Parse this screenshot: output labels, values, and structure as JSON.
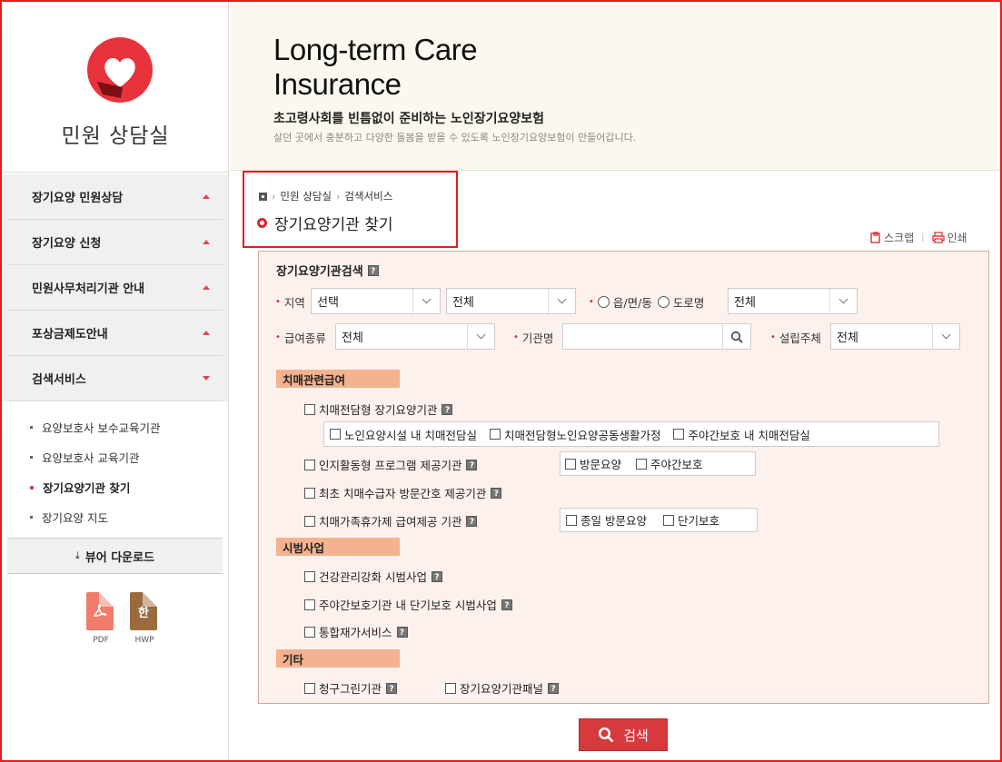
{
  "sidebar": {
    "title": "민원 상담실",
    "menu": [
      {
        "label": "장기요양 민원상담",
        "expanded": false
      },
      {
        "label": "장기요양 신청",
        "expanded": false
      },
      {
        "label": "민원사무처리기관 안내",
        "expanded": false
      },
      {
        "label": "포상금제도안내",
        "expanded": false
      },
      {
        "label": "검색서비스",
        "expanded": true
      }
    ],
    "submenu": [
      "요양보호사 보수교육기관",
      "요양보호사 교육기관",
      "장기요양기관 찾기",
      "장기요양 지도"
    ],
    "active_submenu": "장기요양기관 찾기",
    "viewer_download": "뷰어 다운로드",
    "files": [
      {
        "label": "PDF",
        "icon": "pdf-icon"
      },
      {
        "label": "HWP",
        "icon": "hwp-icon",
        "glyph": "한"
      }
    ]
  },
  "banner": {
    "title_line1": "Long-term Care",
    "title_line2": "Insurance",
    "subtitle": "초고령사회를 빈틈없이 준비하는 노인장기요양보험",
    "description": "살던 곳에서 충분하고 다양한 돌봄을 받을 수 있도록 노인장기요양보험이 만들어갑니다."
  },
  "breadcrumb": {
    "items": [
      "민원 상담실",
      "검색서비스"
    ],
    "page_title": "장기요양기관 찾기"
  },
  "tools": {
    "scrap": "스크랩",
    "print": "인쇄"
  },
  "search": {
    "title": "장기요양기관검색",
    "region_label": "지역",
    "region_select1": "선택",
    "region_select2": "전체",
    "radio_town": "읍/면/동",
    "radio_road": "도로명",
    "region_select3": "전체",
    "benefit_label": "급여종류",
    "benefit_select": "전체",
    "institution_label": "기관명",
    "institution_value": "",
    "founder_label": "설립주체",
    "founder_select": "전체"
  },
  "sections": {
    "dementia": {
      "title": "치매관련급여",
      "dementia_only": "치매전담형 장기요양기관",
      "sub_options": [
        "노인요양시설 내 치매전담실",
        "치매전담형노인요양공동생활가정",
        "주야간보호 내 치매전담실"
      ],
      "cognitive": "인지활동형 프로그램 제공기관",
      "cognitive_options": [
        "방문요양",
        "주야간보호"
      ],
      "first_visit": "최초 치매수급자 방문간호 제공기관",
      "family_respite": "치매가족휴가제 급여제공 기관",
      "respite_options": [
        "종일 방문요양",
        "단기보호"
      ]
    },
    "pilot": {
      "title": "시범사업",
      "items": [
        "건강관리강화 시범사업",
        "주야간보호기관 내 단기보호 시범사업",
        "통합재가서비스"
      ]
    },
    "etc": {
      "title": "기타",
      "items": [
        "청구그린기관",
        "장기요양기관패널"
      ]
    }
  },
  "search_button": "검색",
  "colors": {
    "accent": "#d9262d",
    "section": "#f4b28f",
    "panel": "#fdf1ee",
    "banner": "#fbf8ef"
  }
}
